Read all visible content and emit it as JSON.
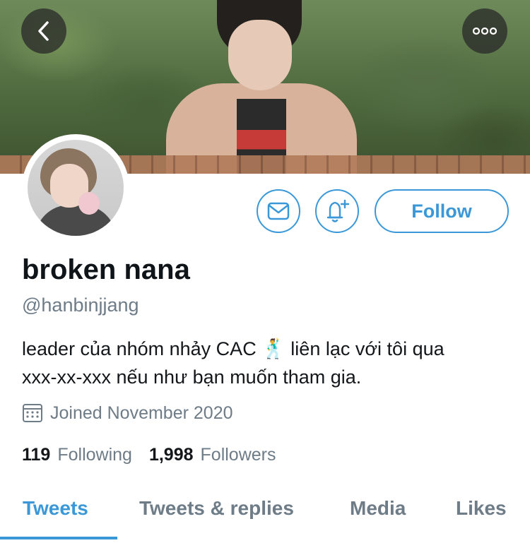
{
  "nav": {
    "back_icon": "chevron-left-icon",
    "more_icon": "ellipsis-icon"
  },
  "profile": {
    "display_name": "broken nana",
    "handle": "@hanbinjjang",
    "bio_line1": "leader của nhóm nhảy CAC 🕺 liên lạc với tôi qua",
    "bio_line2": "xxx-xx-xxx nếu như bạn muốn tham gia.",
    "joined": "Joined November 2020"
  },
  "actions": {
    "follow_label": "Follow",
    "message_icon": "envelope-icon",
    "notify_icon": "bell-plus-icon"
  },
  "stats": {
    "following_count": "119",
    "following_label": "Following",
    "followers_count": "1,998",
    "followers_label": "Followers"
  },
  "tabs": [
    {
      "label": "Tweets",
      "active": true
    },
    {
      "label": "Tweets & replies",
      "active": false
    },
    {
      "label": "Media",
      "active": false
    },
    {
      "label": "Likes",
      "active": false
    }
  ],
  "colors": {
    "accent": "#3a98d8",
    "muted": "#6e7c88",
    "text": "#0f1419"
  }
}
